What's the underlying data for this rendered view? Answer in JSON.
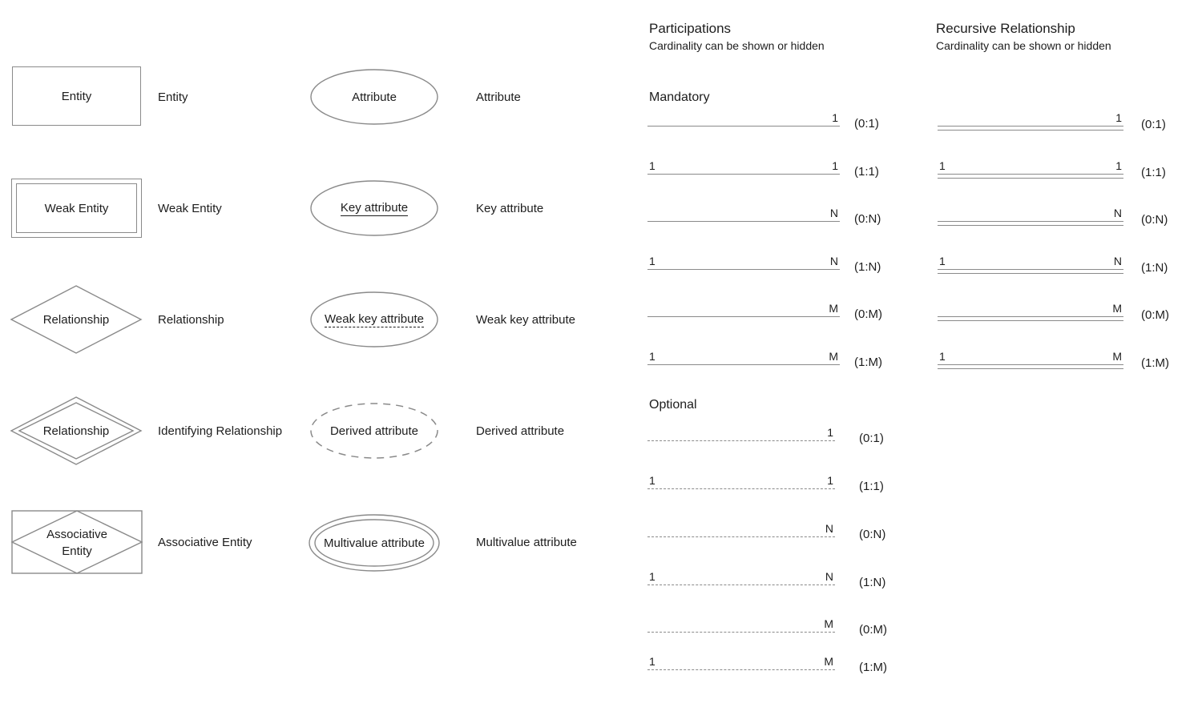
{
  "symbols": {
    "entity": {
      "shape_text": "Entity",
      "label": "Entity"
    },
    "weak_entity": {
      "shape_text": "Weak Entity",
      "label": "Weak Entity"
    },
    "relationship": {
      "shape_text": "Relationship",
      "label": "Relationship"
    },
    "identifying": {
      "shape_text": "Relationship",
      "label": "Identifying Relationship"
    },
    "associative": {
      "shape_text_line1": "Associative",
      "shape_text_line2": "Entity",
      "label": "Associative Entity"
    },
    "attribute": {
      "shape_text": "Attribute",
      "label": "Attribute"
    },
    "key_attribute": {
      "shape_text": "Key attribute",
      "label": "Key attribute"
    },
    "weak_key": {
      "shape_text": "Weak key attribute",
      "label": "Weak key attribute"
    },
    "derived": {
      "shape_text": "Derived attribute",
      "label": "Derived attribute"
    },
    "multivalue": {
      "shape_text": "Multivalue attribute",
      "label": "Multivalue attribute"
    }
  },
  "participations": {
    "title": "Participations",
    "subtitle": "Cardinality can be shown or hidden",
    "mandatory_heading": "Mandatory",
    "optional_heading": "Optional",
    "mandatory_rows": [
      {
        "left": "",
        "right": "1",
        "paren": "(0:1)"
      },
      {
        "left": "1",
        "right": "1",
        "paren": "(1:1)"
      },
      {
        "left": "",
        "right": "N",
        "paren": "(0:N)"
      },
      {
        "left": "1",
        "right": "N",
        "paren": "(1:N)"
      },
      {
        "left": "",
        "right": "M",
        "paren": "(0:M)"
      },
      {
        "left": "1",
        "right": "M",
        "paren": "(1:M)"
      }
    ],
    "optional_rows": [
      {
        "left": "",
        "right": "1",
        "paren": "(0:1)"
      },
      {
        "left": "1",
        "right": "1",
        "paren": "(1:1)"
      },
      {
        "left": "",
        "right": "N",
        "paren": "(0:N)"
      },
      {
        "left": "1",
        "right": "N",
        "paren": "(1:N)"
      },
      {
        "left": "",
        "right": "M",
        "paren": "(0:M)"
      },
      {
        "left": "1",
        "right": "M",
        "paren": "(1:M)"
      }
    ]
  },
  "recursive": {
    "title": "Recursive Relationship",
    "subtitle": "Cardinality can be shown or hidden",
    "rows": [
      {
        "left": "",
        "right": "1",
        "paren": "(0:1)"
      },
      {
        "left": "1",
        "right": "1",
        "paren": "(1:1)"
      },
      {
        "left": "",
        "right": "N",
        "paren": "(0:N)"
      },
      {
        "left": "1",
        "right": "N",
        "paren": "(1:N)"
      },
      {
        "left": "",
        "right": "M",
        "paren": "(0:M)"
      },
      {
        "left": "1",
        "right": "M",
        "paren": "(1:M)"
      }
    ]
  },
  "colors": {
    "stroke": "#8a8a8a",
    "text": "#1d1d1d",
    "background": "#ffffff"
  }
}
